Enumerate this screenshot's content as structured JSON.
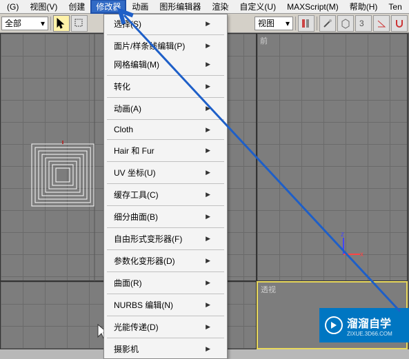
{
  "menubar": {
    "items": [
      "(G)",
      "视图(V)",
      "创建",
      "修改器",
      "动画",
      "图形编辑器",
      "渲染",
      "自定义(U)",
      "MAXScript(M)",
      "帮助(H)",
      "Ten"
    ]
  },
  "toolbar": {
    "filter": "全部",
    "view_label": "视图"
  },
  "viewports": {
    "tr_label": "前",
    "br_label": "透视"
  },
  "dropdown": {
    "items": [
      {
        "label": "选择(S)",
        "arrow": true
      },
      {
        "sep": true
      },
      {
        "label": "面片/样条线编辑(P)",
        "arrow": true
      },
      {
        "label": "网格编辑(M)",
        "arrow": true
      },
      {
        "sep": true
      },
      {
        "label": "转化",
        "arrow": true
      },
      {
        "sep": true
      },
      {
        "label": "动画(A)",
        "arrow": true
      },
      {
        "sep": true
      },
      {
        "label": "Cloth",
        "arrow": true
      },
      {
        "sep": true
      },
      {
        "label": "Hair 和 Fur",
        "arrow": true
      },
      {
        "sep": true
      },
      {
        "label": "UV 坐标(U)",
        "arrow": true
      },
      {
        "sep": true
      },
      {
        "label": "缓存工具(C)",
        "arrow": true
      },
      {
        "sep": true
      },
      {
        "label": "细分曲面(B)",
        "arrow": true
      },
      {
        "sep": true
      },
      {
        "label": "自由形式变形器(F)",
        "arrow": true
      },
      {
        "sep": true
      },
      {
        "label": "参数化变形器(D)",
        "arrow": true
      },
      {
        "sep": true
      },
      {
        "label": "曲面(R)",
        "arrow": true
      },
      {
        "sep": true
      },
      {
        "label": "NURBS 编辑(N)",
        "arrow": true
      },
      {
        "sep": true
      },
      {
        "label": "光能传递(D)",
        "arrow": true
      },
      {
        "sep": true
      },
      {
        "label": "摄影机",
        "arrow": true
      }
    ]
  },
  "axis": {
    "z": "z",
    "x": "x"
  },
  "watermark": {
    "main": "溜溜自学",
    "sub": "ZIXUE.3D66.COM"
  }
}
